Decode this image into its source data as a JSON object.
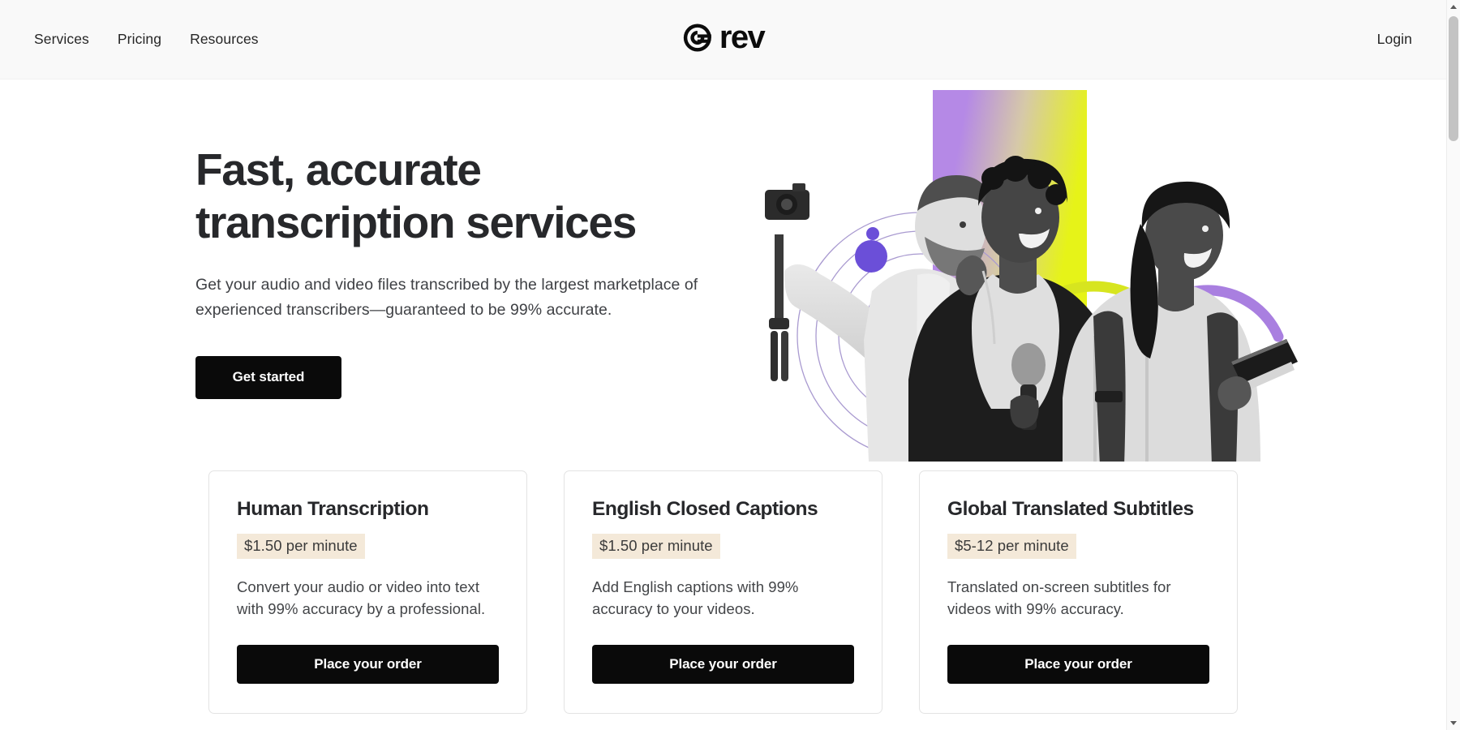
{
  "header": {
    "nav": [
      {
        "label": "Services",
        "name": "nav-link-services"
      },
      {
        "label": "Pricing",
        "name": "nav-link-pricing"
      },
      {
        "label": "Resources",
        "name": "nav-link-resources"
      }
    ],
    "logo": {
      "wordmark": "rev",
      "icon": "rev-spiral-icon"
    },
    "login_label": "Login",
    "background_color": "#f9f9f9"
  },
  "hero": {
    "title": "Fast, accurate transcription services",
    "subtitle": "Get your audio and video files transcribed by the largest marketplace of experienced transcribers—guaranteed to be 99% accurate.",
    "cta_label": "Get started",
    "artwork": {
      "description": "Three people in black and white: a man holding a camera on a tripod, a woman with earphones holding a microphone, a woman with a backpack carrying a book",
      "gradient_start": "#b589e6",
      "gradient_end": "#e6f318",
      "accent_purple": "#6b4fd8",
      "accent_yellow": "#d7ee1c",
      "arc_purple": "#a97fe0",
      "arc_yellow": "#d7e51f"
    }
  },
  "cards": [
    {
      "title": "Human Transcription",
      "price": "$1.50 per minute",
      "description": "Convert your audio or video into text with 99% accuracy by a professional.",
      "button_label": "Place your order",
      "name": "card-human-transcription"
    },
    {
      "title": "English Closed Captions",
      "price": "$1.50 per minute",
      "description": "Add English captions with 99% accuracy to your videos.",
      "button_label": "Place your order",
      "name": "card-english-closed-captions"
    },
    {
      "title": "Global Translated Subtitles",
      "price": "$5-12 per minute",
      "description": "Translated on-screen subtitles for videos with 99% accuracy.",
      "button_label": "Place your order",
      "name": "card-global-translated-subtitles"
    }
  ],
  "colors": {
    "button_black": "#0a0a0a",
    "price_badge_background": "#f4e9d9",
    "card_border": "#e3e3e3",
    "text_primary": "#27282b",
    "text_body": "#434548"
  },
  "scrollbar": {
    "up_arrow": "scroll-up-arrow",
    "down_arrow": "scroll-down-arrow",
    "thumb": "scroll-thumb"
  }
}
